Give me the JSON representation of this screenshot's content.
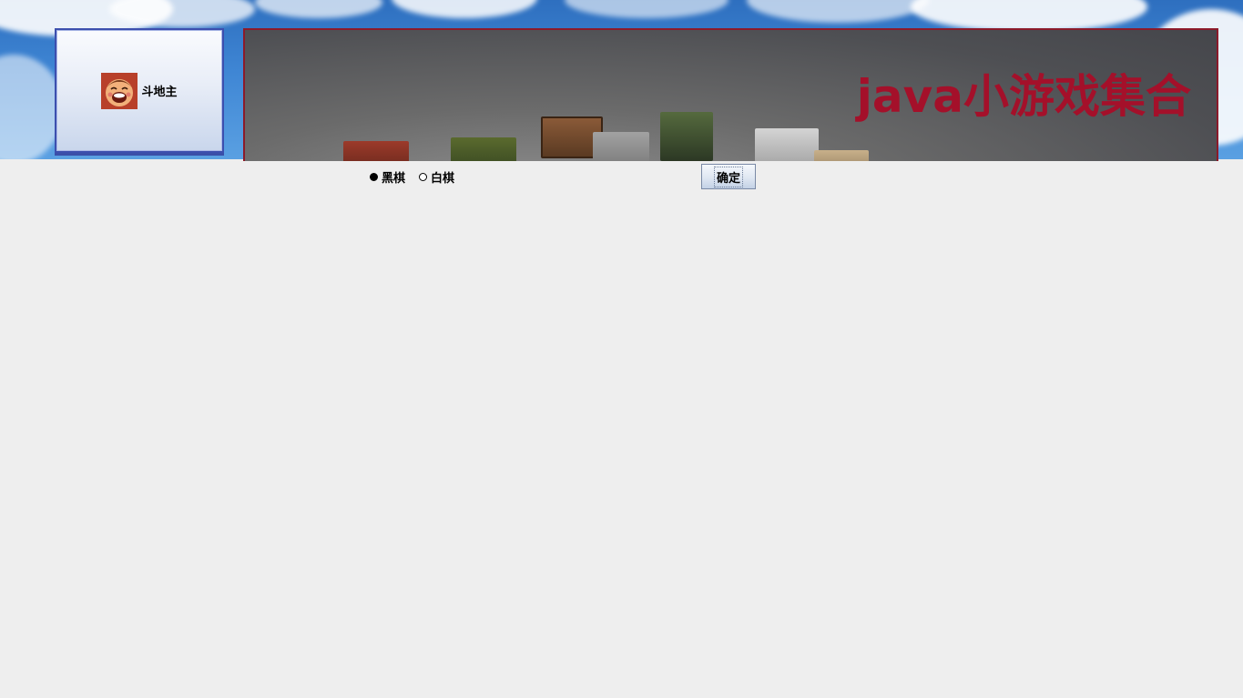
{
  "games": [
    {
      "label": "斗地主",
      "icon": "landlord-avatar-icon"
    }
  ],
  "banner": {
    "title": "java小游戏集合"
  },
  "options": {
    "colors": [
      {
        "label": "黑棋",
        "selected": true
      },
      {
        "label": "白棋",
        "selected": false
      }
    ],
    "confirm_label": "确定"
  },
  "theme": {
    "title_color": "#a4102a",
    "card_border": "#3c4fae",
    "banner_border": "#8c1a2a"
  }
}
